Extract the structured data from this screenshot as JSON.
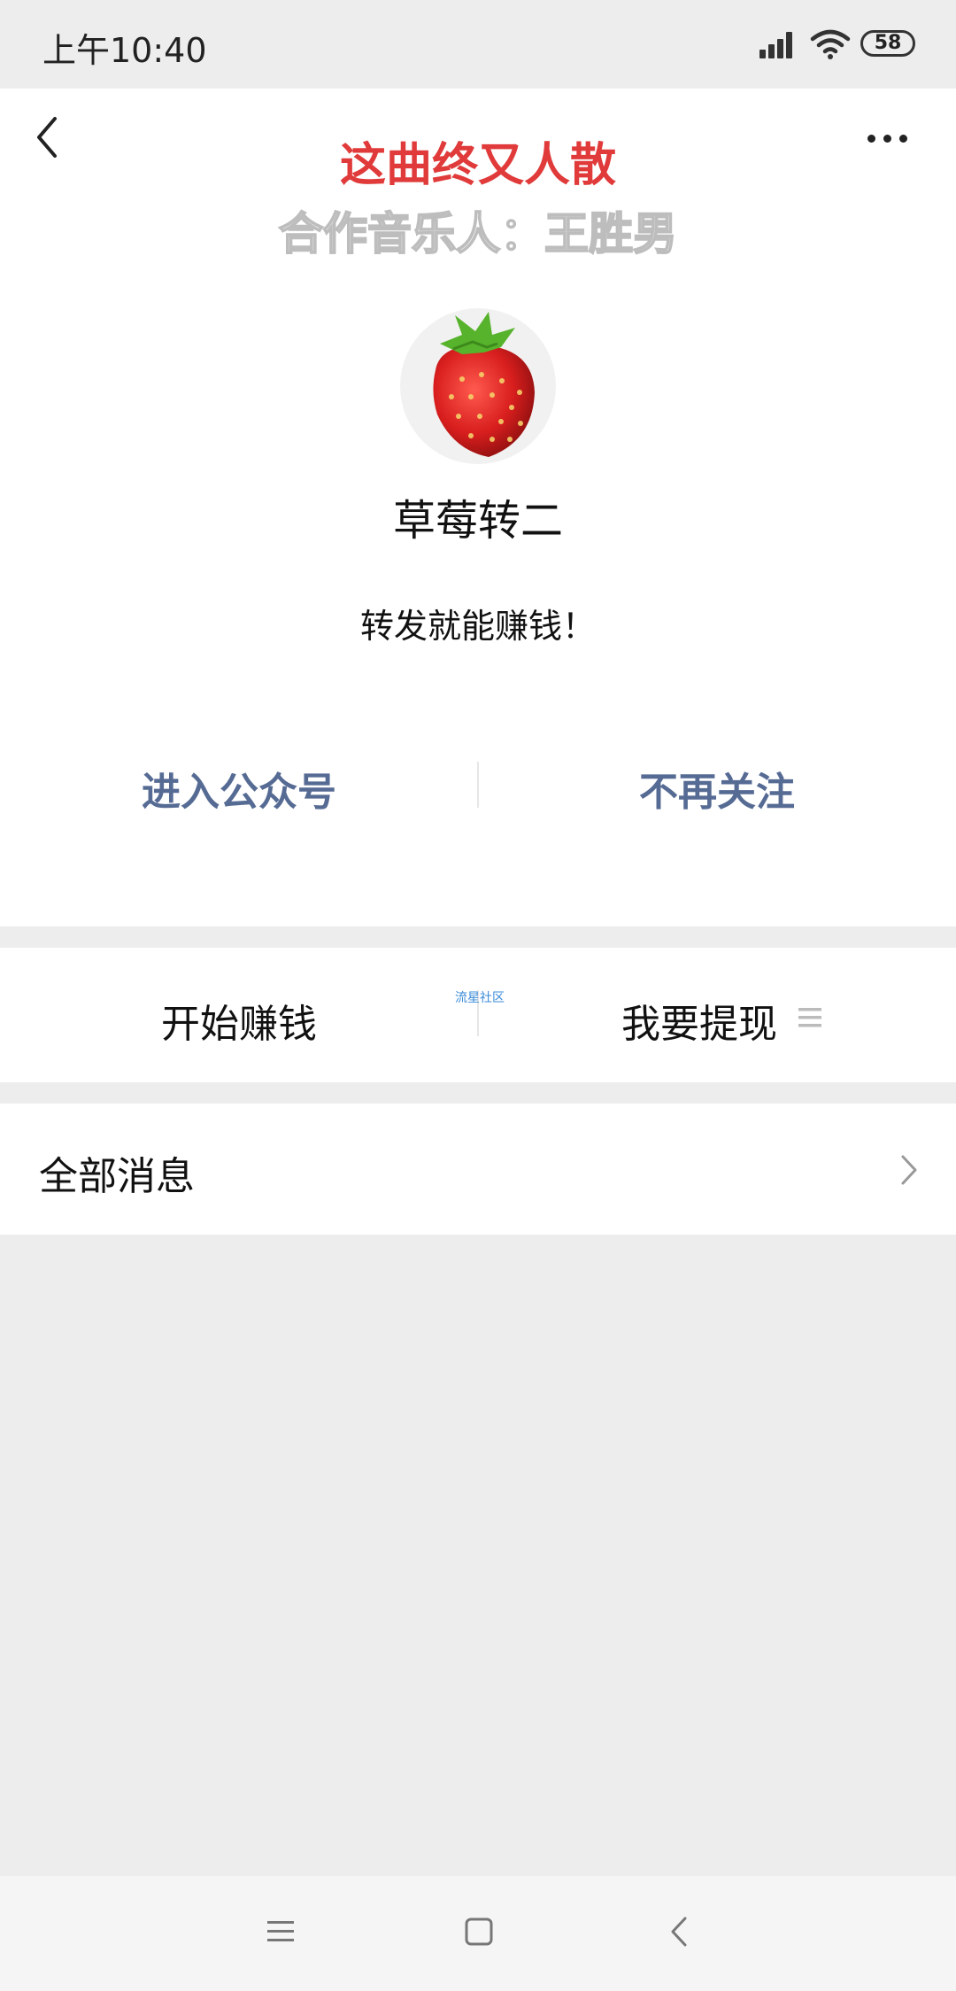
{
  "status_bar": {
    "time": "上午10:40",
    "battery": "58"
  },
  "header": {
    "back_icon": "chevron-left-icon",
    "more_icon": "more-dots-icon"
  },
  "song": {
    "title": "这曲终又人散",
    "subtitle": "合作音乐人：王胜男"
  },
  "profile": {
    "avatar_icon": "strawberry-avatar",
    "name": "草莓转二",
    "description": "转发就能赚钱！"
  },
  "actions": {
    "enter_label": "进入公众号",
    "unfollow_label": "不再关注"
  },
  "menu": {
    "items": [
      {
        "label": "开始赚钱"
      },
      {
        "label": "我要提现"
      }
    ],
    "watermark": "流星社区",
    "menu_icon": "list-lines-icon"
  },
  "messages": {
    "label": "全部消息"
  },
  "colors": {
    "title_red": "#e03a3a",
    "link_blue": "#566b94",
    "background": "#ededed"
  }
}
